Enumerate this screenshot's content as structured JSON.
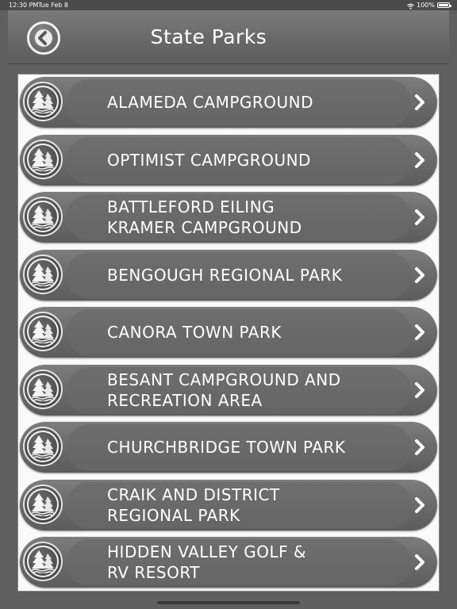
{
  "status_bar": {
    "time": "12:30 PM",
    "date": "Tue Feb 8",
    "battery": "100%",
    "wifi_icon": "wifi-icon",
    "battery_icon": "battery-icon"
  },
  "nav": {
    "title": "State Parks",
    "back_icon": "back-chevron-icon"
  },
  "parks": [
    {
      "label": "ALAMEDA CAMPGROUND",
      "icon": "pine-trees-icon"
    },
    {
      "label": "OPTIMIST CAMPGROUND",
      "icon": "pine-trees-icon"
    },
    {
      "label": "BATTLEFORD EILING\nKRAMER CAMPGROUND",
      "icon": "pine-trees-icon"
    },
    {
      "label": "BENGOUGH REGIONAL PARK",
      "icon": "pine-trees-icon"
    },
    {
      "label": "CANORA TOWN PARK",
      "icon": "pine-trees-icon"
    },
    {
      "label": "BESANT CAMPGROUND AND\nRECREATION AREA",
      "icon": "pine-trees-icon"
    },
    {
      "label": "CHURCHBRIDGE TOWN PARK",
      "icon": "pine-trees-icon"
    },
    {
      "label": "CRAIK AND DISTRICT\nREGIONAL PARK",
      "icon": "pine-trees-icon"
    },
    {
      "label": "HIDDEN VALLEY GOLF &\nRV RESORT",
      "icon": "pine-trees-icon"
    }
  ],
  "colors": {
    "background": "#5f5f5f",
    "list_background": "#fafafa",
    "row": "#6c6c6c",
    "text": "#ffffff"
  }
}
